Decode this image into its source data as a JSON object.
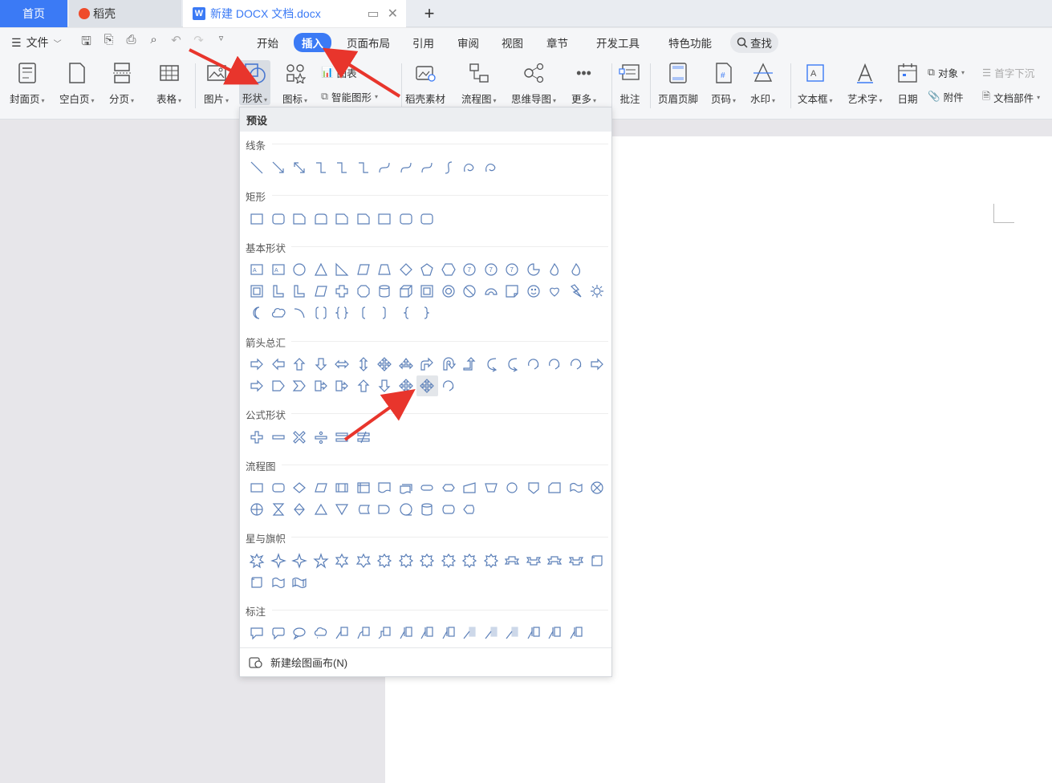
{
  "tabs": {
    "home": "首页",
    "daoke": "稻壳",
    "document": "新建 DOCX 文档.docx",
    "add": "+"
  },
  "menu": {
    "file": "文件",
    "tabs": [
      "开始",
      "插入",
      "页面布局",
      "引用",
      "审阅",
      "视图",
      "章节",
      "开发工具",
      "特色功能"
    ],
    "active_tab": "插入",
    "search": "查找"
  },
  "ribbon": {
    "cover": "封面页",
    "blank": "空白页",
    "pagebreak": "分页",
    "table": "表格",
    "picture": "图片",
    "shape": "形状",
    "icon": "图标",
    "chart": "图表",
    "smartart": "智能图形",
    "material": "稻壳素材",
    "flowchart": "流程图",
    "mindmap": "思维导图",
    "more": "更多",
    "comment": "批注",
    "header_footer": "页眉页脚",
    "page_number": "页码",
    "watermark": "水印",
    "textbox": "文本框",
    "wordart": "艺术字",
    "date": "日期",
    "object": "对象",
    "attachment": "附件",
    "dropcap": "首字下沉",
    "docparts": "文档部件"
  },
  "panel": {
    "header": "预设",
    "sections": {
      "lines": "线条",
      "rect": "矩形",
      "basic": "基本形状",
      "arrows": "箭头总汇",
      "formula": "公式形状",
      "flowchart": "流程图",
      "stars": "星与旗帜",
      "callouts": "标注"
    },
    "footer": "新建绘图画布(N)"
  },
  "colors": {
    "accent": "#3b7af5",
    "shape_stroke": "#5b7fb8",
    "annotation_arrow": "#e8352c"
  }
}
